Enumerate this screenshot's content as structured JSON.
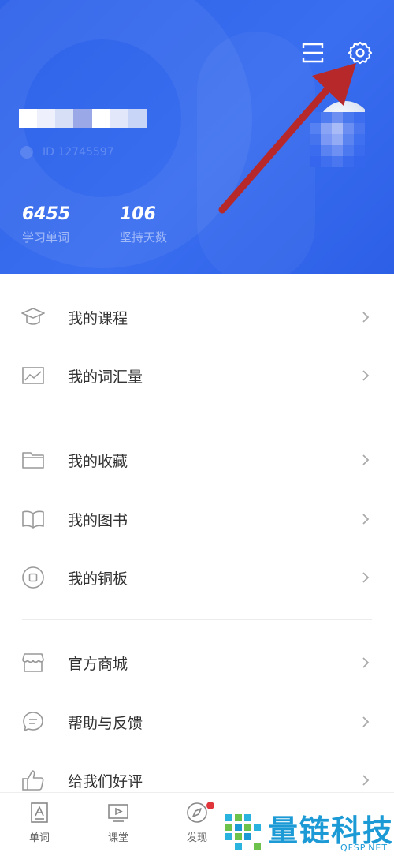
{
  "profile": {
    "user_id_text": "ID 12745597",
    "stats": [
      {
        "value": "6455",
        "label": "学习单词"
      },
      {
        "value": "106",
        "label": "坚持天数"
      }
    ]
  },
  "header_icons": {
    "scan": "scan-icon",
    "settings": "gear-icon"
  },
  "menu": {
    "items": [
      {
        "label": "我的课程",
        "icon": "graduation-cap-icon"
      },
      {
        "label": "我的词汇量",
        "icon": "line-chart-icon"
      },
      {
        "label": "我的收藏",
        "icon": "folder-icon"
      },
      {
        "label": "我的图书",
        "icon": "open-book-icon"
      },
      {
        "label": "我的铜板",
        "icon": "coin-icon"
      },
      {
        "label": "官方商城",
        "icon": "store-icon"
      },
      {
        "label": "帮助与反馈",
        "icon": "chat-bubble-icon"
      },
      {
        "label": "给我们好评",
        "icon": "thumbs-up-icon"
      }
    ]
  },
  "tabbar": {
    "tabs": [
      {
        "label": "单词",
        "icon": "word-card-icon"
      },
      {
        "label": "课堂",
        "icon": "video-screen-icon"
      },
      {
        "label": "发现",
        "icon": "compass-icon"
      }
    ]
  },
  "watermark": {
    "title": "量链科技",
    "subtitle": "QFSP.NET"
  },
  "colors": {
    "header_blue": "#3166ea",
    "arrow_red": "#b7282b",
    "badge_red": "#e0353a",
    "watermark_blue": "#1c9ad6"
  }
}
